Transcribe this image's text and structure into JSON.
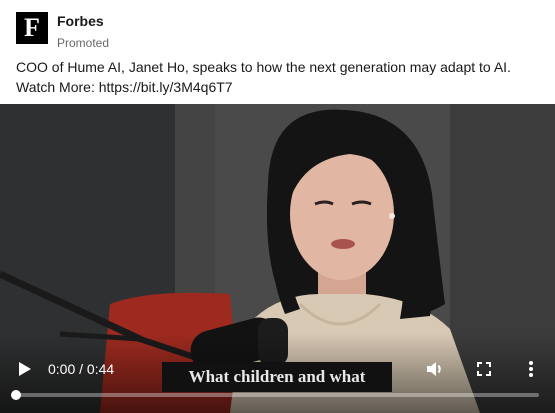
{
  "post": {
    "author": {
      "name": "Forbes",
      "subtitle": "Promoted",
      "logo_letter": "F"
    },
    "text_line1": "COO of Hume AI, Janet Ho, speaks to how the next generation may adapt to AI.",
    "text_line2": "Watch More: https://bit.ly/3M4q6T7"
  },
  "video": {
    "caption": "What children and what",
    "time_display": "0:00 / 0:44",
    "progress": 0,
    "controls": {
      "play_icon": "play-icon",
      "volume_icon": "volume-icon",
      "fullscreen_icon": "fullscreen-icon",
      "more_icon": "more-vertical-icon"
    }
  },
  "colors": {
    "primary_text": "#000000e6",
    "secondary_text": "#00000099",
    "logo_bg": "#000000",
    "caption_bg": "#111111"
  }
}
